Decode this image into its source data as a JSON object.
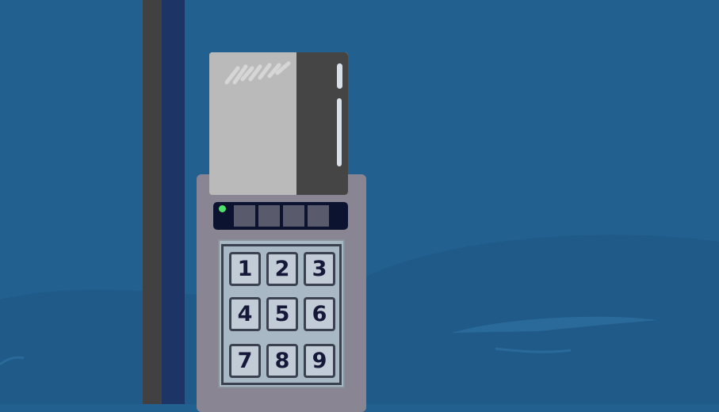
{
  "scene": {
    "colors": {
      "sky": "#22608f",
      "hill_far": "#1f5a89",
      "hill_near": "#1d5688",
      "pole_dark": "#414141",
      "pole_blue": "#1c3466",
      "device_body": "#898592",
      "card_glass": "#bababa",
      "card_dark": "#454545",
      "display": "#0c1330",
      "led_on": "#4ee06a",
      "keypad": "#a8b8c4",
      "key_face": "#c1ccd6",
      "key_ink": "#16183a"
    }
  },
  "device": {
    "card_reader": {
      "status_led": "green"
    },
    "display": {
      "digits": [
        "",
        "",
        "",
        ""
      ]
    },
    "keypad": {
      "keys": [
        "1",
        "2",
        "3",
        "4",
        "5",
        "6",
        "7",
        "8",
        "9"
      ]
    }
  }
}
